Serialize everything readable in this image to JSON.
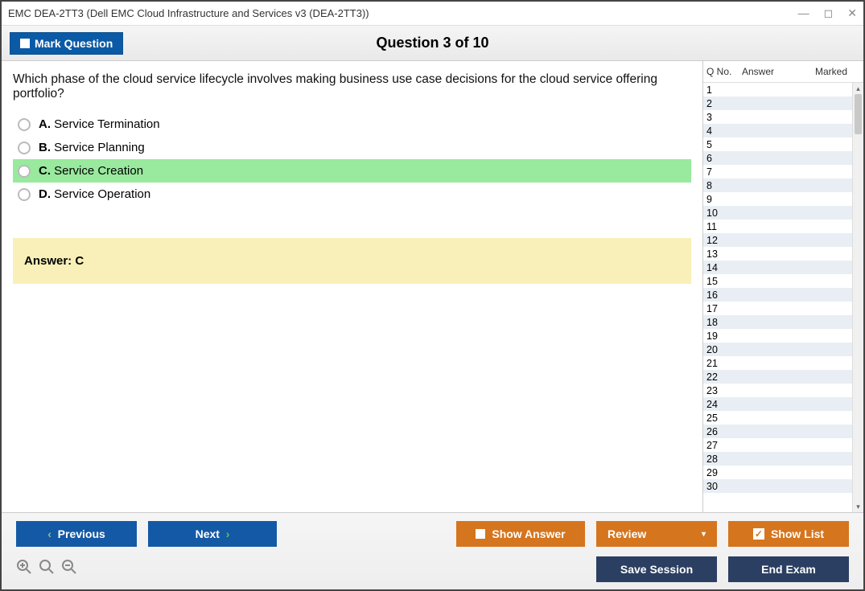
{
  "window": {
    "title": "EMC DEA-2TT3 (Dell EMC Cloud Infrastructure and Services v3 (DEA-2TT3))"
  },
  "header": {
    "mark_label": "Mark Question",
    "question_header": "Question 3 of 10"
  },
  "question": {
    "text": "Which phase of the cloud service lifecycle involves making business use case decisions for the cloud service offering portfolio?",
    "options": [
      {
        "letter": "A.",
        "text": "Service Termination",
        "selected": false
      },
      {
        "letter": "B.",
        "text": "Service Planning",
        "selected": false
      },
      {
        "letter": "C.",
        "text": "Service Creation",
        "selected": true
      },
      {
        "letter": "D.",
        "text": "Service Operation",
        "selected": false
      }
    ],
    "answer_label": "Answer: C"
  },
  "side": {
    "cols": {
      "qno": "Q No.",
      "answer": "Answer",
      "marked": "Marked"
    },
    "rows": [
      1,
      2,
      3,
      4,
      5,
      6,
      7,
      8,
      9,
      10,
      11,
      12,
      13,
      14,
      15,
      16,
      17,
      18,
      19,
      20,
      21,
      22,
      23,
      24,
      25,
      26,
      27,
      28,
      29,
      30
    ]
  },
  "footer": {
    "previous": "Previous",
    "next": "Next",
    "show_answer": "Show Answer",
    "review": "Review",
    "show_list": "Show List",
    "save_session": "Save Session",
    "end_exam": "End Exam"
  }
}
